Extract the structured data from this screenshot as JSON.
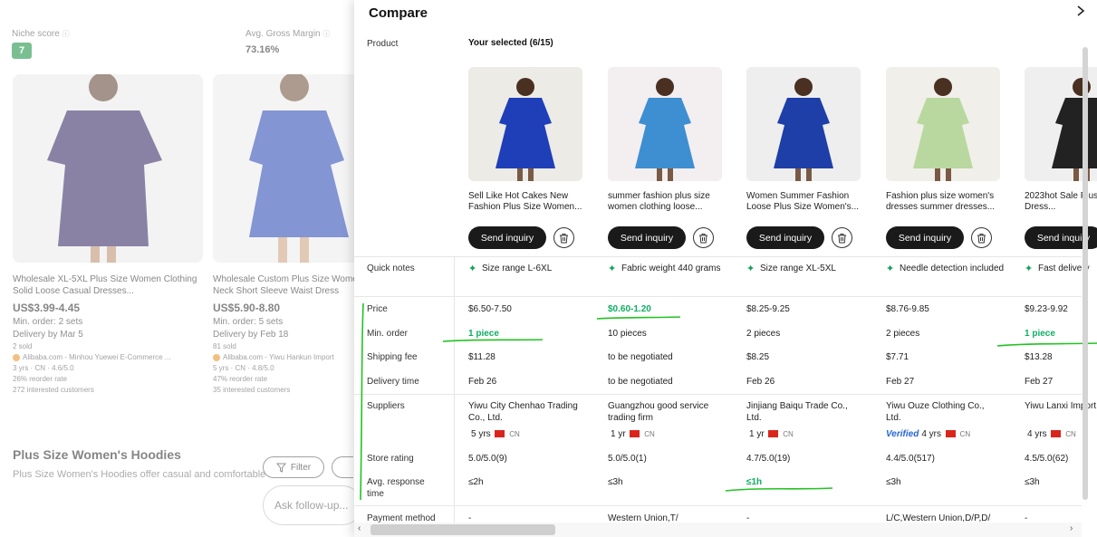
{
  "background": {
    "niche_score_label": "Niche score",
    "niche_score_value": "7",
    "gross_margin_label": "Avg. Gross Margin",
    "gross_margin_value": "73.16%",
    "cards": [
      {
        "title": "Wholesale XL-5XL Plus Size Women Clothing Solid Loose Casual Dresses...",
        "price": "US$3.99-4.45",
        "min_order": "Min. order: 2 sets",
        "delivery": "Delivery by Mar 5",
        "sold": "2 sold",
        "supplier": "Alibaba.com - Minhou Yuewei E-Commerce ...",
        "meta": "3 yrs · CN · 4.6/5.0",
        "reorder": "26% reorder rate",
        "interested": "272 interested customers"
      },
      {
        "title": "Wholesale Custom Plus Size Women Round Neck Short Sleeve Waist Dress",
        "price": "US$5.90-8.80",
        "min_order": "Min. order: 5 sets",
        "delivery": "Delivery by Feb 18",
        "sold": "81 sold",
        "supplier": "Alibaba.com - Yiwu Hankun Import",
        "meta": "5 yrs · CN · 4.8/5.0",
        "reorder": "47% reorder rate",
        "interested": "35 interested customers"
      }
    ],
    "section_title": "Plus Size Women's Hoodies",
    "section_sub": "Plus Size Women's Hoodies offer casual and comfortable",
    "filter_label": "Filter",
    "ask_placeholder": "Ask follow-up..."
  },
  "panel": {
    "title": "Compare",
    "your_selected": "Your selected (6/15)",
    "row_labels": {
      "product": "Product",
      "quick_notes": "Quick notes",
      "price": "Price",
      "min_order": "Min. order",
      "shipping_fee": "Shipping fee",
      "delivery_time": "Delivery time",
      "suppliers": "Suppliers",
      "store_rating": "Store rating",
      "avg_response_time": "Avg. response time",
      "payment_method": "Payment method"
    },
    "send_inquiry_label": "Send inquiry",
    "verified_label": "Verified",
    "products": [
      {
        "name": "Sell Like Hot Cakes New Fashion Plus Size Women...",
        "note": "Size range L-6XL",
        "price": "$6.50-7.50",
        "min_order": "1 piece",
        "shipping_fee": "$11.28",
        "delivery_time": "Feb 26",
        "supplier": "Yiwu City Chenhao Trading Co., Ltd.",
        "years": "5 yrs",
        "country": "CN",
        "store_rating": "5.0/5.0(9)",
        "response": "≤2h",
        "payment": "-",
        "dress_color": "#1f3fb8",
        "bg_color": "#ecebe6",
        "price_green": false,
        "min_order_green": true,
        "response_green": false,
        "verified": false
      },
      {
        "name": "summer fashion plus size women clothing loose...",
        "note": "Fabric weight 440 grams",
        "price": "$0.60-1.20",
        "min_order": "10 pieces",
        "shipping_fee": "to be negotiated",
        "delivery_time": "to be negotiated",
        "supplier": "Guangzhou good service trading firm",
        "years": "1 yr",
        "country": "CN",
        "store_rating": "5.0/5.0(1)",
        "response": "≤3h",
        "payment": "Western Union,T/",
        "dress_color": "#3d8fd1",
        "bg_color": "#f3eef0",
        "price_green": true,
        "min_order_green": false,
        "response_green": false,
        "verified": false
      },
      {
        "name": "Women Summer Fashion Loose Plus Size Women's...",
        "note": "Size range XL-5XL",
        "price": "$8.25-9.25",
        "min_order": "2 pieces",
        "shipping_fee": "$8.25",
        "delivery_time": "Feb 26",
        "supplier": "Jinjiang Baiqu Trade Co., Ltd.",
        "years": "1 yr",
        "country": "CN",
        "store_rating": "4.7/5.0(19)",
        "response": "≤1h",
        "payment": "-",
        "dress_color": "#1e3fa8",
        "bg_color": "#eeeeee",
        "price_green": false,
        "min_order_green": false,
        "response_green": true,
        "verified": false
      },
      {
        "name": "Fashion plus size women's dresses summer dresses...",
        "note": "Needle detection included",
        "price": "$8.76-9.85",
        "min_order": "2 pieces",
        "shipping_fee": "$7.71",
        "delivery_time": "Feb 27",
        "supplier": "Yiwu Ouze Clothing Co., Ltd.",
        "years": "4 yrs",
        "country": "CN",
        "store_rating": "4.4/5.0(517)",
        "response": "≤3h",
        "payment": "L/C,Western Union,D/P,D/",
        "dress_color": "#b9d8a0",
        "bg_color": "#f1efea",
        "price_green": false,
        "min_order_green": false,
        "response_green": false,
        "verified": true
      },
      {
        "name": "2023hot Sale Plus Size Dress...",
        "note": "Fast delivery",
        "price": "$9.23-9.92",
        "min_order": "1 piece",
        "shipping_fee": "$13.28",
        "delivery_time": "Feb 27",
        "supplier": "Yiwu Lanxi Import Co., Ltd.",
        "years": "4 yrs",
        "country": "CN",
        "store_rating": "4.5/5.0(62)",
        "response": "≤3h",
        "payment": "-",
        "dress_color": "#222222",
        "bg_color": "#efefef",
        "price_green": false,
        "min_order_green": true,
        "response_green": false,
        "verified": false
      }
    ]
  }
}
